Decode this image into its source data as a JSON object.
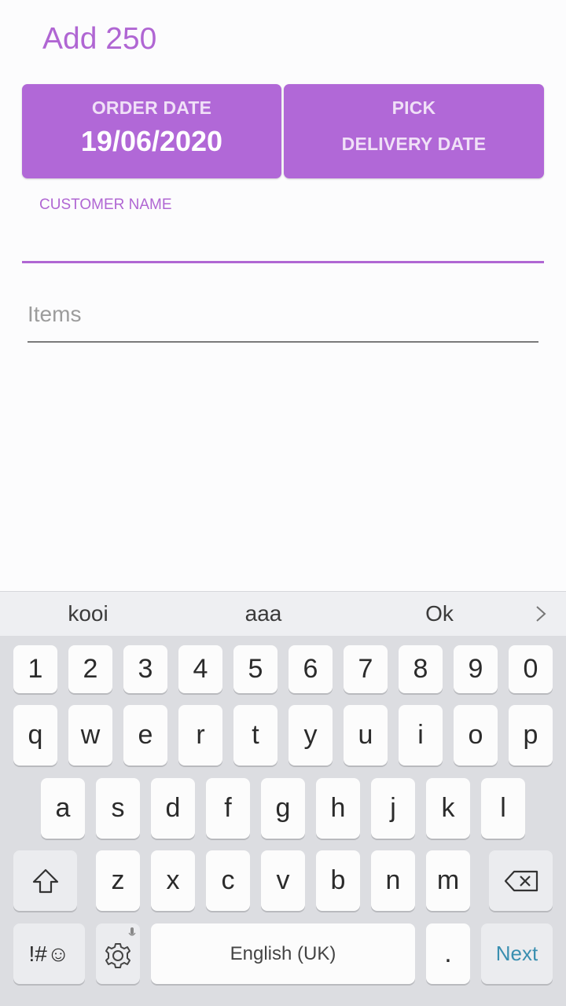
{
  "header": {
    "title": "Add 250"
  },
  "order_date": {
    "label": "ORDER DATE",
    "value": "19/06/2020"
  },
  "delivery_date": {
    "line1": "PICK",
    "line2": "DELIVERY DATE"
  },
  "customer_name": {
    "label": "CUSTOMER NAME",
    "value": ""
  },
  "items": {
    "placeholder": "Items",
    "value": ""
  },
  "accent_color": "#b168d7",
  "keyboard": {
    "suggestions": [
      "kooi",
      "aaa",
      "Ok"
    ],
    "number_row": [
      "1",
      "2",
      "3",
      "4",
      "5",
      "6",
      "7",
      "8",
      "9",
      "0"
    ],
    "row1": [
      "q",
      "w",
      "e",
      "r",
      "t",
      "y",
      "u",
      "i",
      "o",
      "p"
    ],
    "row2": [
      "a",
      "s",
      "d",
      "f",
      "g",
      "h",
      "j",
      "k",
      "l"
    ],
    "row3": [
      "z",
      "x",
      "c",
      "v",
      "b",
      "n",
      "m"
    ],
    "symbols_label": "!#☺",
    "space_label": "English (UK)",
    "period_label": ".",
    "action_label": "Next",
    "icons": [
      "chevron-right-icon",
      "shift-icon",
      "backspace-icon",
      "gear-icon",
      "mic-icon",
      "smiley-icon"
    ]
  }
}
